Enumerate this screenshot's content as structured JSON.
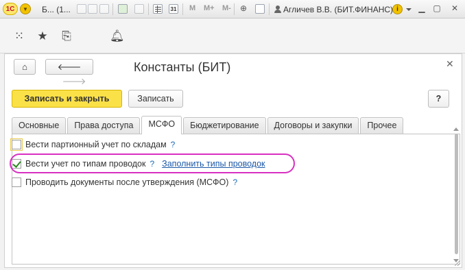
{
  "app": {
    "logo_text": "1С",
    "title_short": "Б... (1..."
  },
  "titlebar": {
    "calendar_label": "31",
    "m_labels": [
      "M",
      "M+",
      "M-"
    ],
    "user": "Агличев В.В. (БИТ.ФИНАНС)",
    "info_label": "i"
  },
  "toolbar2": {
    "icons": [
      "apps-grid-icon",
      "favorites-star-icon",
      "history-icon",
      "bell-icon"
    ]
  },
  "form": {
    "title": "Константы (БИТ)",
    "save_close_label": "Записать и закрыть",
    "save_label": "Записать",
    "help_label": "?",
    "tabs": [
      {
        "label": "Основные",
        "active": false
      },
      {
        "label": "Права доступа",
        "active": false
      },
      {
        "label": "МСФО",
        "active": true
      },
      {
        "label": "Бюджетирование",
        "active": false
      },
      {
        "label": "Договоры и закупки",
        "active": false
      },
      {
        "label": "Прочее",
        "active": false
      }
    ],
    "options": [
      {
        "label": "Вести партионный учет по складам",
        "checked": false,
        "help": "?"
      },
      {
        "label": "Вести учет по типам проводок",
        "checked": true,
        "help": "?",
        "link": "Заполнить типы проводок"
      },
      {
        "label": "Проводить документы после утверждения (МСФО)",
        "checked": false,
        "help": "?"
      }
    ]
  },
  "colors": {
    "primary_button": "#fbe148",
    "highlight": "#d82fc2",
    "link": "#1b58a8"
  }
}
